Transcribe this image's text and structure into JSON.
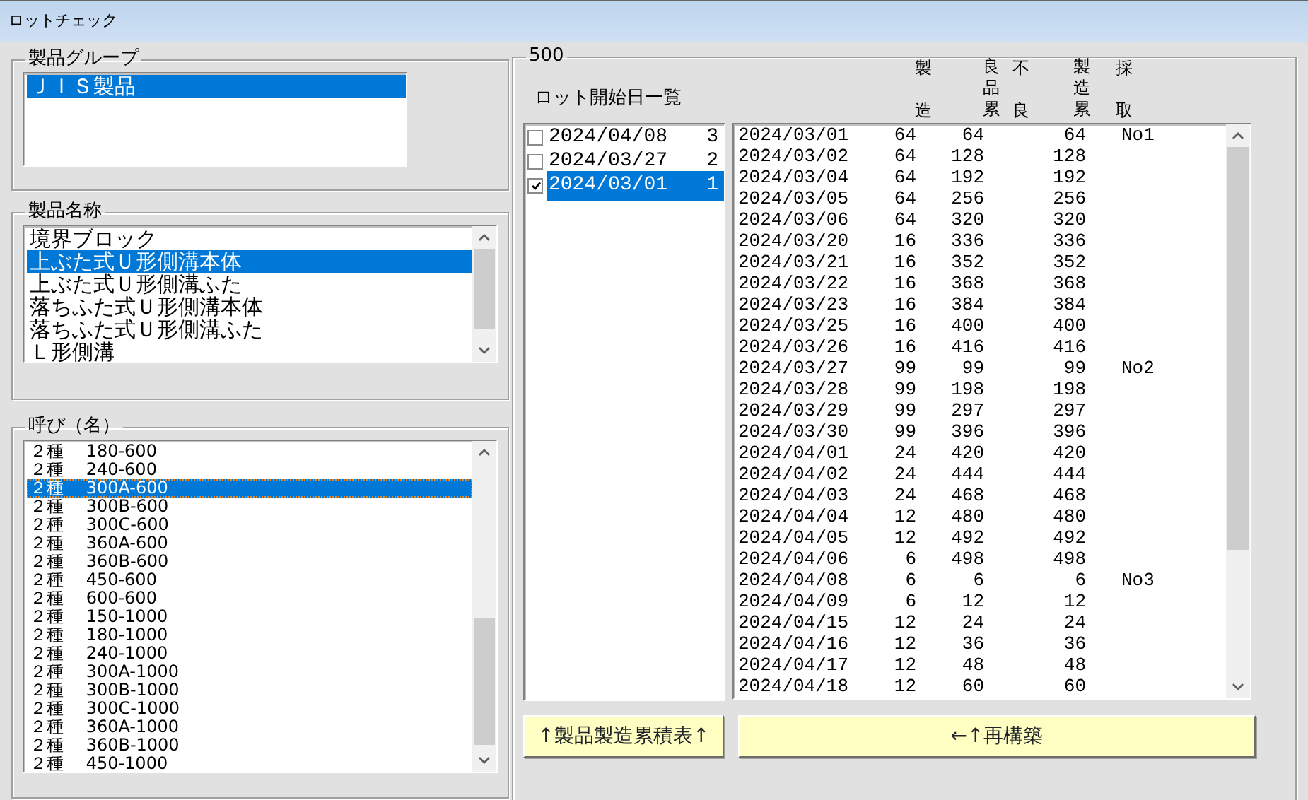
{
  "window": {
    "title": "ロットチェック"
  },
  "product_group": {
    "label": "製品グループ",
    "items": [
      {
        "text": "ＪＩＳ製品",
        "selected": true
      }
    ]
  },
  "product_name": {
    "label": "製品名称",
    "items": [
      {
        "text": "境界ブロック",
        "selected": false
      },
      {
        "text": "上ぶた式Ｕ形側溝本体",
        "selected": true
      },
      {
        "text": "上ぶた式Ｕ形側溝ふた",
        "selected": false
      },
      {
        "text": "落ちふた式Ｕ形側溝本体",
        "selected": false
      },
      {
        "text": "落ちふた式Ｕ形側溝ふた",
        "selected": false
      },
      {
        "text": "Ｌ形側溝",
        "selected": false
      }
    ]
  },
  "nominal": {
    "label": "呼び（名）",
    "items": [
      {
        "text": "２種　 180-600",
        "selected": false
      },
      {
        "text": "２種　 240-600",
        "selected": false
      },
      {
        "text": "２種　 300A-600",
        "selected": true
      },
      {
        "text": "２種　 300B-600",
        "selected": false
      },
      {
        "text": "２種　 300C-600",
        "selected": false
      },
      {
        "text": "２種　 360A-600",
        "selected": false
      },
      {
        "text": "２種　 360B-600",
        "selected": false
      },
      {
        "text": "２種　 450-600",
        "selected": false
      },
      {
        "text": "２種　 600-600",
        "selected": false
      },
      {
        "text": "２種　 150-1000",
        "selected": false
      },
      {
        "text": "２種　 180-1000",
        "selected": false
      },
      {
        "text": "２種　 240-1000",
        "selected": false
      },
      {
        "text": "２種　 300A-1000",
        "selected": false
      },
      {
        "text": "２種　 300B-1000",
        "selected": false
      },
      {
        "text": "２種　 300C-1000",
        "selected": false
      },
      {
        "text": "２種　 360A-1000",
        "selected": false
      },
      {
        "text": "２種　 360B-1000",
        "selected": false
      },
      {
        "text": "２種　 450-1000",
        "selected": false
      }
    ]
  },
  "lot_panel": {
    "label": "500",
    "list_label": "ロット開始日一覧",
    "lots": [
      {
        "date": "2024/04/08",
        "no": "3",
        "checked": false,
        "selected": false
      },
      {
        "date": "2024/03/27",
        "no": "2",
        "checked": false,
        "selected": false
      },
      {
        "date": "2024/03/01",
        "no": "1",
        "checked": true,
        "selected": true
      }
    ],
    "columns": [
      "製造",
      "良品累",
      "不良",
      "製造累",
      "採取"
    ],
    "rows": [
      {
        "date": "2024/03/01",
        "made": "64",
        "good_total": "64",
        "made_total": "64",
        "sample": "No1"
      },
      {
        "date": "2024/03/02",
        "made": "64",
        "good_total": "128",
        "made_total": "128"
      },
      {
        "date": "2024/03/04",
        "made": "64",
        "good_total": "192",
        "made_total": "192"
      },
      {
        "date": "2024/03/05",
        "made": "64",
        "good_total": "256",
        "made_total": "256"
      },
      {
        "date": "2024/03/06",
        "made": "64",
        "good_total": "320",
        "made_total": "320"
      },
      {
        "date": "2024/03/20",
        "made": "16",
        "good_total": "336",
        "made_total": "336"
      },
      {
        "date": "2024/03/21",
        "made": "16",
        "good_total": "352",
        "made_total": "352"
      },
      {
        "date": "2024/03/22",
        "made": "16",
        "good_total": "368",
        "made_total": "368"
      },
      {
        "date": "2024/03/23",
        "made": "16",
        "good_total": "384",
        "made_total": "384"
      },
      {
        "date": "2024/03/25",
        "made": "16",
        "good_total": "400",
        "made_total": "400"
      },
      {
        "date": "2024/03/26",
        "made": "16",
        "good_total": "416",
        "made_total": "416"
      },
      {
        "date": "2024/03/27",
        "made": "99",
        "good_total": "99",
        "made_total": "99",
        "sample": "No2"
      },
      {
        "date": "2024/03/28",
        "made": "99",
        "good_total": "198",
        "made_total": "198"
      },
      {
        "date": "2024/03/29",
        "made": "99",
        "good_total": "297",
        "made_total": "297"
      },
      {
        "date": "2024/03/30",
        "made": "99",
        "good_total": "396",
        "made_total": "396"
      },
      {
        "date": "2024/04/01",
        "made": "24",
        "good_total": "420",
        "made_total": "420"
      },
      {
        "date": "2024/04/02",
        "made": "24",
        "good_total": "444",
        "made_total": "444"
      },
      {
        "date": "2024/04/03",
        "made": "24",
        "good_total": "468",
        "made_total": "468"
      },
      {
        "date": "2024/04/04",
        "made": "12",
        "good_total": "480",
        "made_total": "480"
      },
      {
        "date": "2024/04/05",
        "made": "12",
        "good_total": "492",
        "made_total": "492"
      },
      {
        "date": "2024/04/06",
        "made": "6",
        "good_total": "498",
        "made_total": "498"
      },
      {
        "date": "2024/04/08",
        "made": "6",
        "good_total": "6",
        "made_total": "6",
        "sample": "No3"
      },
      {
        "date": "2024/04/09",
        "made": "6",
        "good_total": "12",
        "made_total": "12"
      },
      {
        "date": "2024/04/15",
        "made": "12",
        "good_total": "24",
        "made_total": "24"
      },
      {
        "date": "2024/04/16",
        "made": "12",
        "good_total": "36",
        "made_total": "36"
      },
      {
        "date": "2024/04/17",
        "made": "12",
        "good_total": "48",
        "made_total": "48"
      },
      {
        "date": "2024/04/18",
        "made": "12",
        "good_total": "60",
        "made_total": "60"
      }
    ]
  },
  "buttons": [
    {
      "label": "↑製品製造累積表↑"
    },
    {
      "label": "←↑再構築"
    }
  ]
}
